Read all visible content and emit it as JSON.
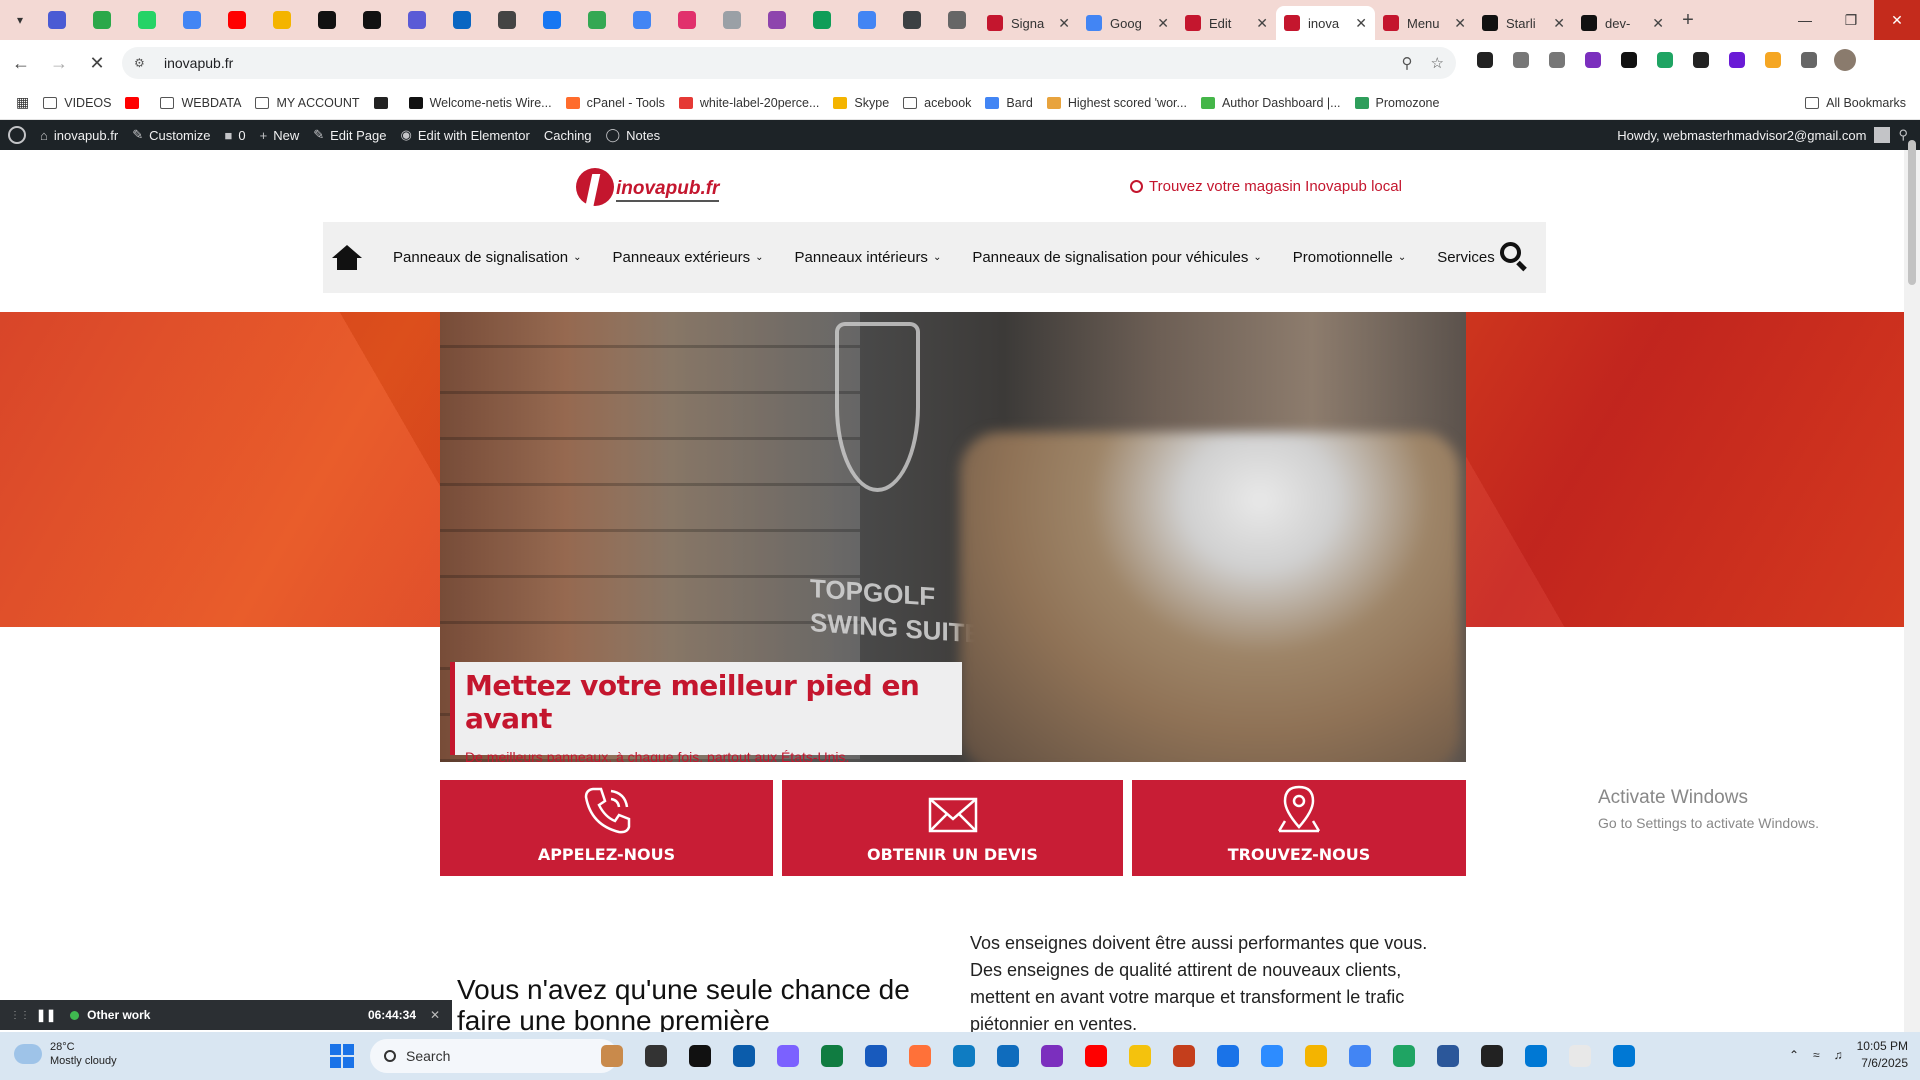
{
  "browser": {
    "pinned_tab_colors": [
      "#4a5bd4",
      "#2ba84a",
      "#25d366",
      "#4285f4",
      "#ff0000",
      "#f4b400",
      "#111111",
      "#111111",
      "#5b5bd6",
      "#0a66c2",
      "#444444",
      "#1877f2",
      "#34a853",
      "#4285f4",
      "#e1306c",
      "#9aa0a6",
      "#8e44ad",
      "#0f9d58",
      "#4285f4",
      "#3c4043",
      "#666666"
    ],
    "tabs": [
      {
        "label": "Signa",
        "color": "#c4162e",
        "active": false
      },
      {
        "label": "Goog",
        "color": "#4285f4",
        "active": false
      },
      {
        "label": "Edit",
        "color": "#c4162e",
        "active": false
      },
      {
        "label": "inova",
        "color": "#c4162e",
        "active": true
      },
      {
        "label": "Menu",
        "color": "#c4162e",
        "active": false
      },
      {
        "label": "Starli",
        "color": "#111111",
        "active": false
      },
      {
        "label": "dev-",
        "color": "#111111",
        "active": false
      }
    ],
    "url": "inovapub.fr",
    "extension_colors": [
      "#222222",
      "#777777",
      "#777777",
      "#7b2fbe",
      "#111111",
      "#1fa463",
      "#222222",
      "#6a1bd6",
      "#f5a623",
      "#666666"
    ]
  },
  "bookmarks": {
    "items": [
      {
        "label": "VIDEOS",
        "type": "folder",
        "color": "#555555"
      },
      {
        "label": "",
        "type": "icon",
        "color": "#ff0000"
      },
      {
        "label": "WEBDATA",
        "type": "folder",
        "color": "#555555"
      },
      {
        "label": "MY ACCOUNT",
        "type": "folder",
        "color": "#555555"
      },
      {
        "label": "",
        "type": "icon",
        "color": "#222222"
      },
      {
        "label": "Welcome-netis Wire...",
        "type": "icon",
        "color": "#111111"
      },
      {
        "label": "cPanel - Tools",
        "type": "icon",
        "color": "#ff6c2c"
      },
      {
        "label": "white-label-20perce...",
        "type": "icon",
        "color": "#e53935"
      },
      {
        "label": "Skype",
        "type": "icon",
        "color": "#f4b400"
      },
      {
        "label": "acebook",
        "type": "folder",
        "color": "#555555"
      },
      {
        "label": "Bard",
        "type": "icon",
        "color": "#4285f4"
      },
      {
        "label": "Highest scored 'wor...",
        "type": "icon",
        "color": "#e8a33d"
      },
      {
        "label": "Author Dashboard |...",
        "type": "icon",
        "color": "#45b649"
      },
      {
        "label": "Promozone",
        "type": "icon",
        "color": "#2e9e5b"
      }
    ],
    "all_label": "All Bookmarks"
  },
  "wpbar": {
    "site": "inovapub.fr",
    "customize": "Customize",
    "comments": "0",
    "new": "New",
    "edit_page": "Edit Page",
    "elementor": "Edit with Elementor",
    "caching": "Caching",
    "notes": "Notes",
    "howdy": "Howdy, webmasterhmadvisor2@gmail.com"
  },
  "site": {
    "logo_text": "inovapub.fr",
    "store_link": "Trouvez votre magasin Inovapub local",
    "nav": [
      "Panneaux de signalisation",
      "Panneaux extérieurs",
      "Panneaux intérieurs",
      "Panneaux de signalisation pour véhicules",
      "Promotionnelle",
      "Services"
    ],
    "hero": {
      "sign_text_1": "TOPGOLF",
      "sign_text_2": "SWING SUITE",
      "title": "Mettez votre meilleur pied en avant",
      "subtitle": "De meilleurs panneaux, à chaque fois, partout aux États-Unis."
    },
    "cta": {
      "call": "APPELEZ-NOUS",
      "quote": "OBTENIR UN DEVIS",
      "find": "TROUVEZ-NOUS"
    },
    "intro_heading": "Vous n'avez qu'une seule chance de faire une bonne première",
    "intro_body": "Vos enseignes doivent être aussi performantes que vous. Des enseignes de qualité attirent de nouveaux clients, mettent en avant votre marque et transforment le trafic piétonnier en ventes.",
    "brand_color": "#c4162e"
  },
  "watermark": {
    "line1": "Activate Windows",
    "line2": "Go to Settings to activate Windows."
  },
  "timer": {
    "label": "Other work",
    "time": "06:44:34"
  },
  "taskbar": {
    "temp": "28°C",
    "weather": "Mostly cloudy",
    "search_label": "Search",
    "app_colors": [
      "#c98a4b",
      "#333333",
      "#111111",
      "#0b5cab",
      "#7b61ff",
      "#107c41",
      "#185abd",
      "#ff7139",
      "#0f7cc2",
      "#0f6cbd",
      "#7b2fbe",
      "#ff0000",
      "#f4c20d",
      "#c43e1c",
      "#1a73e8",
      "#2d8cff",
      "#f4b400",
      "#4285f4",
      "#1fa463",
      "#2b579a",
      "#222222",
      "#0078d4",
      "#e8e8e8",
      "#0078d4"
    ],
    "time": "10:05 PM",
    "date": "7/6/2025"
  }
}
